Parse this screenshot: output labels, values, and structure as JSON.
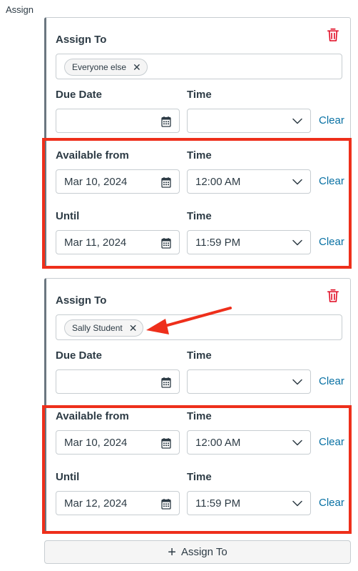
{
  "page_label": "Assign",
  "cards": [
    {
      "assign_to_label": "Assign To",
      "assignee": "Everyone else",
      "due_date_label": "Due Date",
      "due_time_label": "Time",
      "due_date_value": "",
      "due_time_value": "",
      "available_from_label": "Available from",
      "available_time_label": "Time",
      "available_from_date": "Mar 10, 2024",
      "available_from_time": "12:00 AM",
      "until_label": "Until",
      "until_time_label": "Time",
      "until_date": "Mar 11, 2024",
      "until_time": "11:59 PM",
      "clear_label": "Clear"
    },
    {
      "assign_to_label": "Assign To",
      "assignee": "Sally Student",
      "due_date_label": "Due Date",
      "due_time_label": "Time",
      "due_date_value": "",
      "due_time_value": "",
      "available_from_label": "Available from",
      "available_time_label": "Time",
      "available_from_date": "Mar 10, 2024",
      "available_from_time": "12:00 AM",
      "until_label": "Until",
      "until_time_label": "Time",
      "until_date": "Mar 12, 2024",
      "until_time": "11:59 PM",
      "clear_label": "Clear"
    }
  ],
  "add_button_label": "Assign To",
  "colors": {
    "highlight": "#ee2f1b",
    "link": "#0770a3",
    "trash": "#e0061f"
  },
  "icons": [
    "trash-icon",
    "close-icon",
    "calendar-icon",
    "chevron-down-icon",
    "plus-icon"
  ]
}
